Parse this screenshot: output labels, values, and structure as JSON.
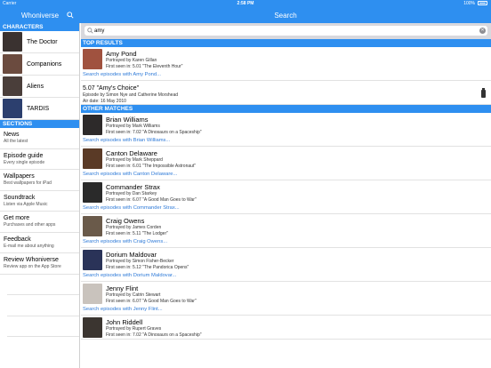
{
  "status_bar": {
    "carrier": "Carrier",
    "time": "2:58 PM",
    "battery": "100%"
  },
  "navbar": {
    "left_title": "Whoniverse",
    "title": "Search"
  },
  "sidebar": {
    "characters_header": "CHARACTERS",
    "characters": [
      {
        "label": "The Doctor",
        "thumb": "#3a3230"
      },
      {
        "label": "Companions",
        "thumb": "#6b4b3f"
      },
      {
        "label": "Aliens",
        "thumb": "#4a3e3a"
      },
      {
        "label": "TARDIS",
        "thumb": "#2c3f6e"
      }
    ],
    "sections_header": "SECTIONS",
    "sections": [
      {
        "title": "News",
        "subtitle": "All the latest"
      },
      {
        "title": "Episode guide",
        "subtitle": "Every single episode"
      },
      {
        "title": "Wallpapers",
        "subtitle": "Best wallpapers for iPad"
      },
      {
        "title": "Soundtrack",
        "subtitle": "Listen via Apple Music"
      },
      {
        "title": "Get more",
        "subtitle": "Purchases and other apps"
      },
      {
        "title": "Feedback",
        "subtitle": "E-mail me about anything"
      },
      {
        "title": "Review Whoniverse",
        "subtitle": "Review app on the App Store"
      }
    ]
  },
  "search": {
    "value": "amy",
    "clear_icon": "clear-icon"
  },
  "top_results_header": "TOP RESULTS",
  "top_result": {
    "name": "Amy Pond",
    "portrayed": "Portrayed by Karen Gillan",
    "first_seen": "First seen in: 5.01 \"The Eleventh Hour\"",
    "link": "Search episodes with Amy Pond...",
    "thumb": "#a0523f"
  },
  "episode_result": {
    "title": "5.07 \"Amy's Choice\"",
    "credits": "Episode by Simon Nye and Catherine Morshead",
    "air_date": "Air date: 16 May 2010",
    "icon": "bottle-icon"
  },
  "other_matches_header": "OTHER MATCHES",
  "other_matches": [
    {
      "name": "Brian Williams",
      "portrayed": "Portrayed by Mark Williams",
      "first_seen": "First seen in: 7.02 \"A Dinosaurs on a Spaceship\"",
      "link": "Search episodes with Brian Williams...",
      "thumb": "#2d2a2a"
    },
    {
      "name": "Canton Delaware",
      "portrayed": "Portrayed by Mark Sheppard",
      "first_seen": "First seen in: 6.01 \"The Impossible Astronaut\"",
      "link": "Search episodes with Canton Delaware...",
      "thumb": "#5a3a26"
    },
    {
      "name": "Commander Strax",
      "portrayed": "Portrayed by Dan Starkey",
      "first_seen": "First seen in: 6.07 \"A Good Man Goes to War\"",
      "link": "Search episodes with Commander Strax...",
      "thumb": "#2a2a2a"
    },
    {
      "name": "Craig Owens",
      "portrayed": "Portrayed by James Corden",
      "first_seen": "First seen in: 5.11 \"The Lodger\"",
      "link": "Search episodes with Craig Owens...",
      "thumb": "#6a5a4a"
    },
    {
      "name": "Dorium Maldovar",
      "portrayed": "Portrayed by Simon Fisher-Becker",
      "first_seen": "First seen in: 5.12 \"The Pandorica Opens\"",
      "link": "Search episodes with Dorium Maldovar...",
      "thumb": "#2a3358"
    },
    {
      "name": "Jenny Flint",
      "portrayed": "Portrayed by Catrin Stewart",
      "first_seen": "First seen in: 6.07 \"A Good Man Goes to War\"",
      "link": "Search episodes with Jenny Flint...",
      "thumb": "#c9c3bd"
    },
    {
      "name": "John Riddell",
      "portrayed": "Portrayed by Rupert Graves",
      "first_seen": "First seen in: 7.02 \"A Dinosaurs on a Spaceship\"",
      "link": "",
      "thumb": "#3b3530"
    }
  ]
}
